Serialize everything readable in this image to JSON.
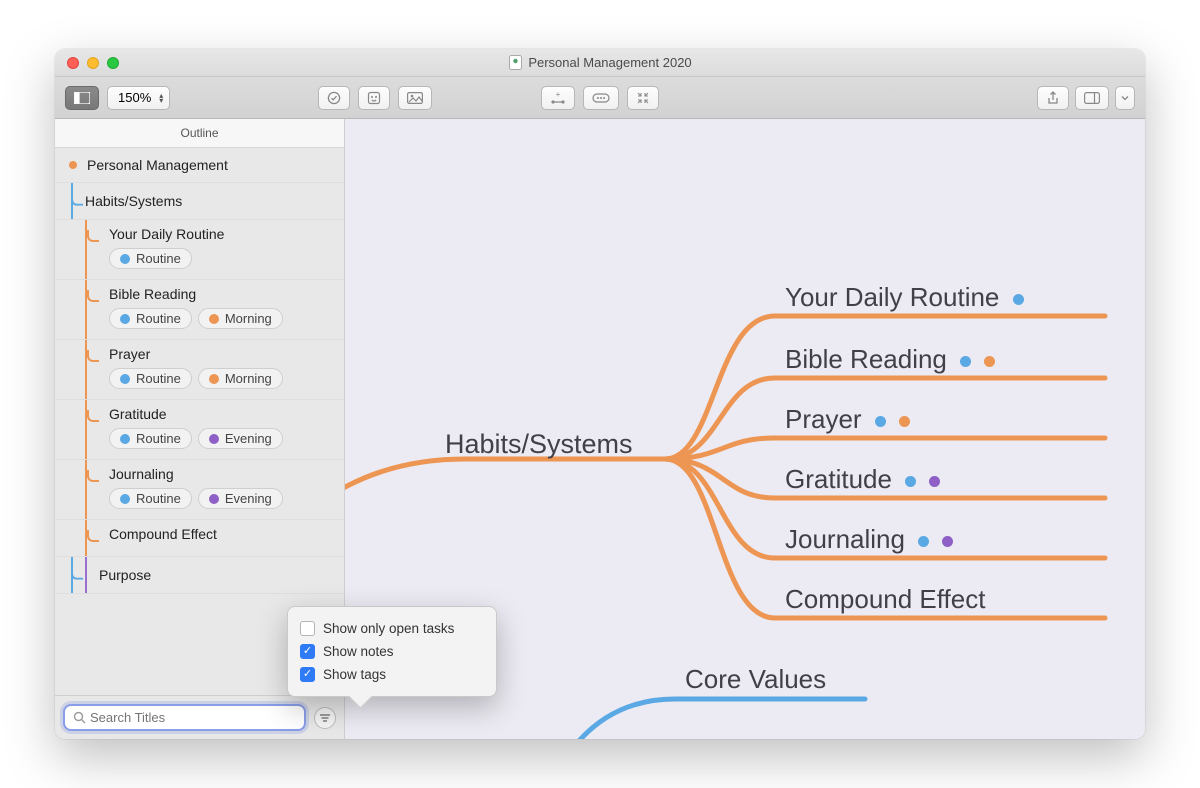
{
  "window": {
    "title": "Personal Management 2020"
  },
  "toolbar": {
    "zoom": "150%"
  },
  "sidebar": {
    "tab": "Outline",
    "root": "Personal Management",
    "items": [
      {
        "label": "Habits/Systems",
        "children": [
          {
            "label": "Your Daily Routine",
            "tags": [
              {
                "name": "Routine",
                "color": "#5aa8e4"
              }
            ]
          },
          {
            "label": "Bible Reading",
            "tags": [
              {
                "name": "Routine",
                "color": "#5aa8e4"
              },
              {
                "name": "Morning",
                "color": "#ed9552"
              }
            ]
          },
          {
            "label": "Prayer",
            "tags": [
              {
                "name": "Routine",
                "color": "#5aa8e4"
              },
              {
                "name": "Morning",
                "color": "#ed9552"
              }
            ]
          },
          {
            "label": "Gratitude",
            "tags": [
              {
                "name": "Routine",
                "color": "#5aa8e4"
              },
              {
                "name": "Evening",
                "color": "#8e5fc6"
              }
            ]
          },
          {
            "label": "Journaling",
            "tags": [
              {
                "name": "Routine",
                "color": "#5aa8e4"
              },
              {
                "name": "Evening",
                "color": "#8e5fc6"
              }
            ]
          },
          {
            "label": "Compound Effect",
            "tags": []
          }
        ]
      },
      {
        "label": "Purpose"
      }
    ],
    "search_placeholder": "Search Titles"
  },
  "popover": {
    "opt1": "Show only open tasks",
    "opt2": "Show notes",
    "opt3": "Show tags",
    "opt1_on": false,
    "opt2_on": true,
    "opt3_on": true
  },
  "canvas": {
    "center": "Habits/Systems",
    "branches": [
      {
        "label": "Your Daily Routine",
        "dots": [
          "#5aa8e4"
        ]
      },
      {
        "label": "Bible Reading",
        "dots": [
          "#5aa8e4",
          "#ed9552"
        ]
      },
      {
        "label": "Prayer",
        "dots": [
          "#5aa8e4",
          "#ed9552"
        ]
      },
      {
        "label": "Gratitude",
        "dots": [
          "#5aa8e4",
          "#8e5fc6"
        ]
      },
      {
        "label": "Journaling",
        "dots": [
          "#5aa8e4",
          "#8e5fc6"
        ]
      },
      {
        "label": "Compound Effect",
        "dots": []
      }
    ],
    "extra": "Core Values"
  },
  "colors": {
    "orange": "#ed9552",
    "blue": "#5aa8e4",
    "purple": "#8e5fc6"
  }
}
